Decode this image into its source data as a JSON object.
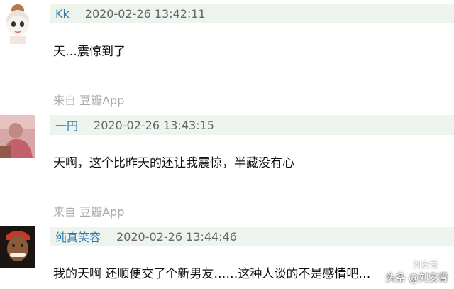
{
  "comments": [
    {
      "name": "Kk",
      "time": "2020-02-26 13:42:11",
      "text": "天…震惊到了",
      "source": "来自 豆瓣App"
    },
    {
      "name": "一円",
      "time": "2020-02-26 13:43:15",
      "text": "天啊，这个比昨天的还让我震惊，半藏没有心",
      "source": "来自 豆瓣App"
    },
    {
      "name": "纯真笑容",
      "time": "2020-02-26 13:44:46",
      "text": "我的天啊 还顺便交了个新男友……这种人谈的不是感情吧…"
    }
  ],
  "watermark": {
    "line1": "刘安青",
    "line2": "头条 @刘安青"
  },
  "colors": {
    "header_bg": "#edf4ed",
    "name_link": "#3377aa",
    "source_gray": "#aaaaaa"
  }
}
